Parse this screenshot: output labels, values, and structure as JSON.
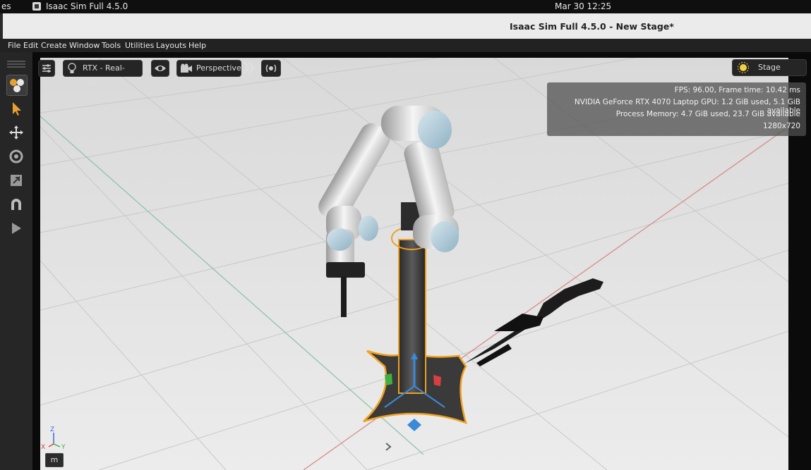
{
  "os_bar": {
    "left_fragment": "es",
    "app_name": "Isaac Sim Full 4.5.0",
    "clock": "Mar 30  12:25"
  },
  "window": {
    "title": "Isaac Sim Full 4.5.0 - New Stage*"
  },
  "menu": [
    "File",
    "Edit",
    "Create",
    "Window",
    "Tools",
    "Utilities",
    "Layouts",
    "Help"
  ],
  "left_tools": [
    {
      "name": "select-mode-icon",
      "selected": true
    },
    {
      "name": "select-arrow-icon"
    },
    {
      "name": "move-icon"
    },
    {
      "name": "rotate-icon"
    },
    {
      "name": "scale-icon"
    },
    {
      "name": "snap-magnet-icon"
    },
    {
      "name": "play-icon"
    }
  ],
  "viewport": {
    "renderer_label": "RTX - Real-Time",
    "camera_label": "Perspective",
    "stage_lights_label": "Stage Lights",
    "stats": {
      "fps": "FPS: 96.00, Frame time: 10.42 ms",
      "gpu": "NVIDIA GeForce RTX 4070 Laptop GPU: 1.2 GiB used, 5.1 GiB available",
      "memory": "Process Memory: 4.7 GiB used, 23.7 GiB available",
      "resolution": "1280x720"
    },
    "axis_labels": {
      "z": "Z",
      "x": "X",
      "y": "Y"
    },
    "unit": "m"
  },
  "colors": {
    "selection_outline": "#f0a020",
    "gizmo_blue": "#3a8ad8",
    "gizmo_green": "#40b040",
    "gizmo_red": "#d84040"
  }
}
